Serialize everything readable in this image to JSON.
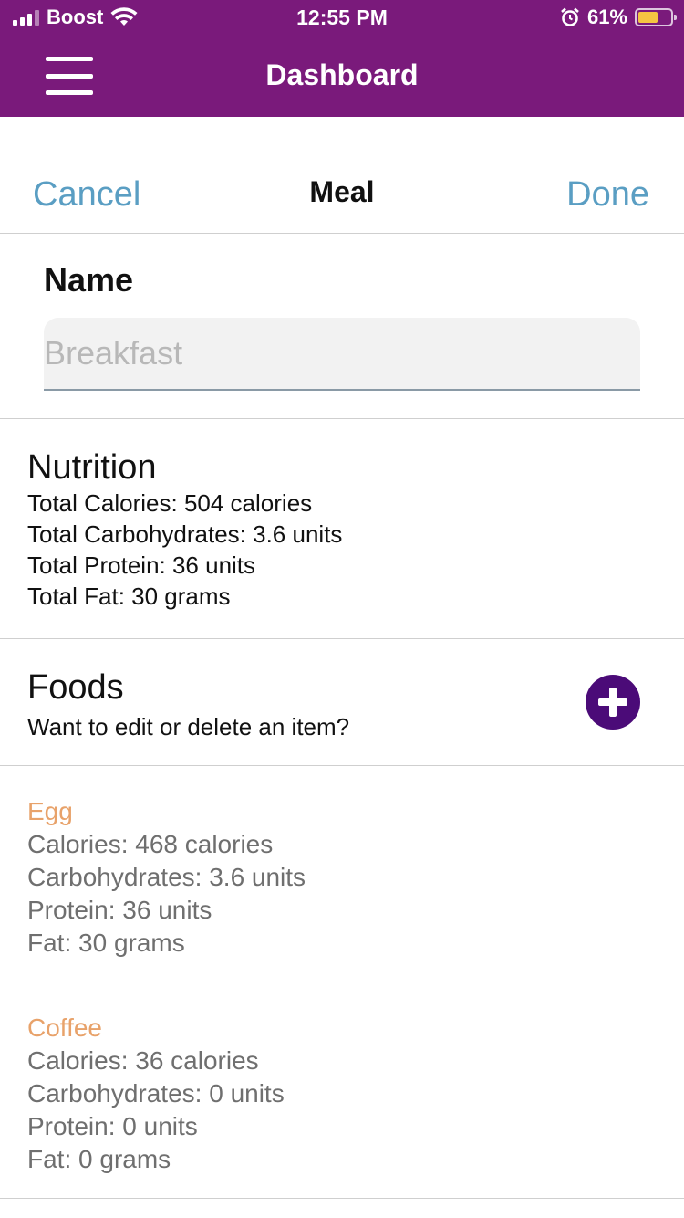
{
  "status_bar": {
    "carrier": "Boost",
    "time": "12:55 PM",
    "battery_percent_label": "61%",
    "battery_level": 0.61
  },
  "nav": {
    "title": "Dashboard"
  },
  "sheet": {
    "cancel_label": "Cancel",
    "title": "Meal",
    "done_label": "Done"
  },
  "name_section": {
    "label": "Name",
    "placeholder": "Breakfast",
    "value": ""
  },
  "nutrition": {
    "title": "Nutrition",
    "lines": [
      "Total Calories: 504 calories",
      "Total Carbohydrates: 3.6 units",
      "Total Protein: 36 units",
      "Total Fat: 30 grams"
    ]
  },
  "foods": {
    "title": "Foods",
    "subtitle": "Want to edit or delete an item?",
    "items": [
      {
        "name": "Egg",
        "calories": "Calories: 468 calories",
        "carbs": "Carbohydrates: 3.6 units",
        "protein": "Protein: 36 units",
        "fat": "Fat: 30 grams"
      },
      {
        "name": "Coffee",
        "calories": "Calories: 36 calories",
        "carbs": "Carbohydrates: 0 units",
        "protein": "Protein: 0 units",
        "fat": "Fat: 0 grams"
      }
    ]
  },
  "colors": {
    "nav_bg": "#7a1a7b",
    "link": "#5a9ec3",
    "food_name": "#e8a26a",
    "add_button": "#4b0b78"
  },
  "icons": [
    "signal-icon",
    "wifi-icon",
    "alarm-icon",
    "battery-icon",
    "hamburger-icon",
    "add-icon"
  ]
}
